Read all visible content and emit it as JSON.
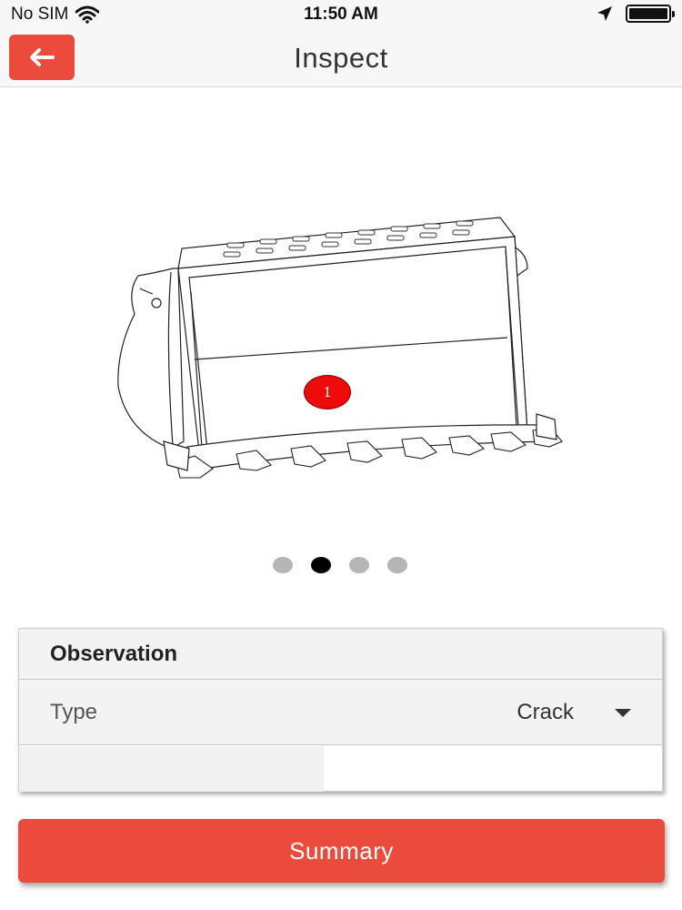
{
  "status_bar": {
    "carrier": "No SIM",
    "time": "11:50 AM",
    "icons": [
      "wifi-icon",
      "location-arrow-icon",
      "battery-icon"
    ]
  },
  "nav": {
    "title": "Inspect",
    "back_icon": "arrow-left-icon"
  },
  "figure": {
    "subject": "bucket-drawing",
    "marker_label": "1",
    "marker_color": "#ee0b0b"
  },
  "pager": {
    "pages": 4,
    "active_index": 1
  },
  "observation": {
    "header": "Observation",
    "type_label": "Type",
    "type_value": "Crack"
  },
  "summary_button": {
    "label": "Summary"
  },
  "colors": {
    "accent": "#ea4b3c",
    "nav_bg": "#f7f7f7"
  }
}
